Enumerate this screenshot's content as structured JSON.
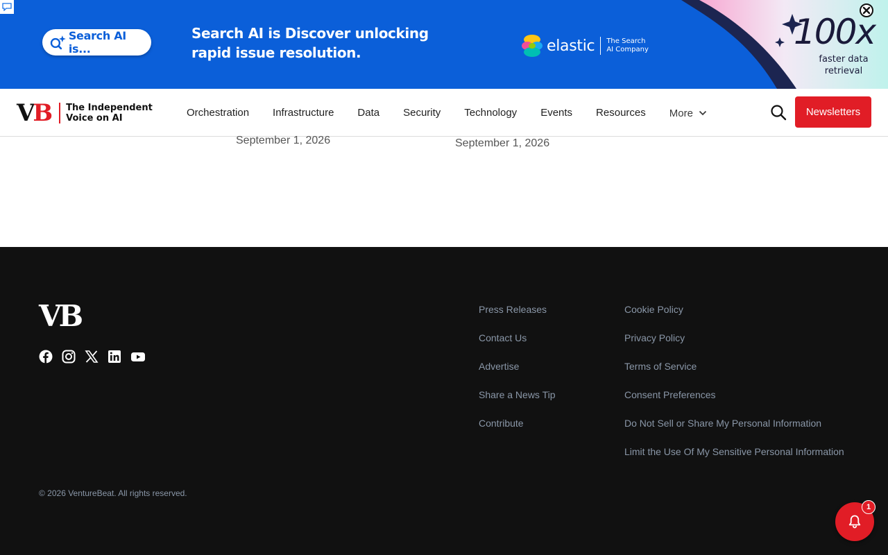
{
  "ad": {
    "pill_text": "Search AI is...",
    "headline": "Search AI is Discover unlocking rapid issue resolution.",
    "brand_name": "elastic",
    "brand_sub_1": "The Search",
    "brand_sub_2": "AI Company",
    "big_text": "100x",
    "sub_text": "faster data retrieval",
    "colors": {
      "background": "#0b5fd9",
      "ink": "#1a1a3a"
    }
  },
  "header": {
    "logo": {
      "v": "V",
      "b": "B"
    },
    "tagline_1": "The Independent",
    "tagline_2": "Voice on AI",
    "nav": [
      "Orchestration",
      "Infrastructure",
      "Data",
      "Security",
      "Technology",
      "Events",
      "Resources"
    ],
    "more_label": "More",
    "newsletters_label": "Newsletters",
    "colors": {
      "accent": "#e11d26"
    }
  },
  "content": {
    "dates": [
      "September 1, 2026",
      "September 1, 2026"
    ]
  },
  "footer": {
    "logo": "VB",
    "social": [
      "facebook-icon",
      "instagram-icon",
      "x-icon",
      "linkedin-icon",
      "youtube-icon"
    ],
    "col1": [
      "Press Releases",
      "Contact Us",
      "Advertise",
      "Share a News Tip",
      "Contribute"
    ],
    "col2": [
      "Cookie Policy",
      "Privacy Policy",
      "Terms of Service",
      "Consent Preferences",
      "Do Not Sell or Share My Personal Information",
      "Limit the Use Of My Sensitive Personal Information"
    ],
    "copyright": "© 2026 VentureBeat. All rights reserved.",
    "colors": {
      "background": "#111111",
      "link": "#8a97a8"
    }
  },
  "notification": {
    "count": "1"
  }
}
